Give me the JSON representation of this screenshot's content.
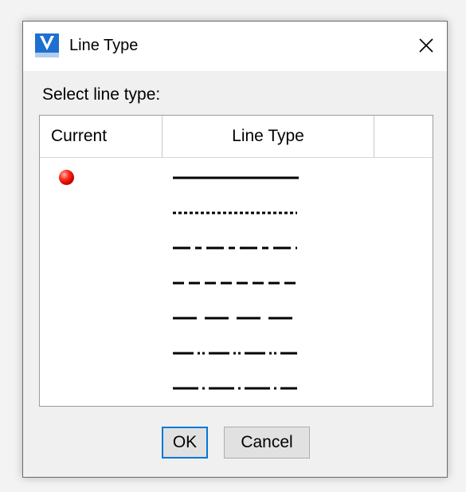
{
  "window": {
    "title": "Line Type",
    "app_icon": "vcad-app-icon",
    "close_icon": "close-icon"
  },
  "dialog": {
    "prompt": "Select line type:",
    "columns": [
      "Current",
      "Line Type",
      ""
    ],
    "rows": [
      {
        "current": true,
        "pattern": "continuous"
      },
      {
        "current": false,
        "pattern": "dotted"
      },
      {
        "current": false,
        "pattern": "dash-dot"
      },
      {
        "current": false,
        "pattern": "dashed"
      },
      {
        "current": false,
        "pattern": "long-dash"
      },
      {
        "current": false,
        "pattern": "dash-dot-dot"
      },
      {
        "current": false,
        "pattern": "dash-dot-long"
      }
    ],
    "current_indicator_color": "#e00000"
  },
  "buttons": {
    "ok": "OK",
    "cancel": "Cancel"
  },
  "colors": {
    "focus": "#0078d7",
    "app_icon_blue": "#1f6fd1"
  }
}
